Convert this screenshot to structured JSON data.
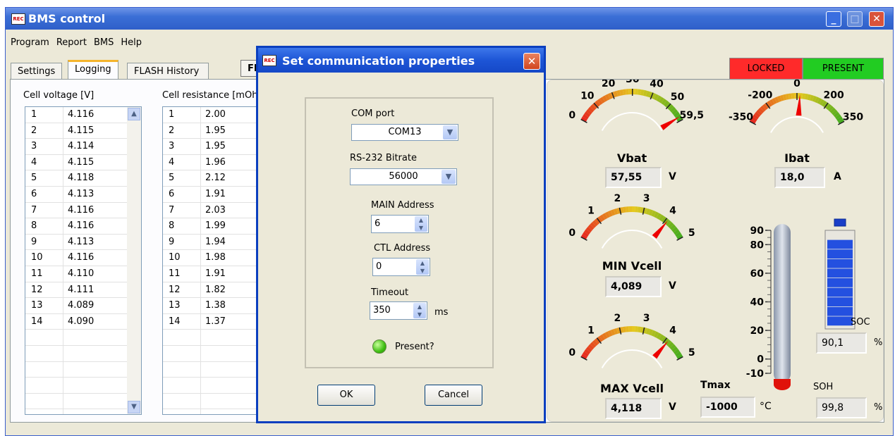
{
  "window": {
    "title": "BMS control",
    "app_icon_text": "REC",
    "controls": {
      "minimize": "_",
      "maximize": "□",
      "close": "✕"
    }
  },
  "menu": [
    "Program",
    "Report",
    "BMS",
    "Help"
  ],
  "tabs": [
    "Settings",
    "Logging",
    "FLASH History",
    "FE"
  ],
  "indicators": {
    "locked": {
      "label": "LOCKED",
      "color": "#ff2a2a"
    },
    "present": {
      "label": "PRESENT",
      "color": "#22cc22"
    }
  },
  "cell_voltage": {
    "label": "Cell voltage [V]",
    "rows": [
      [
        "1",
        "4.116"
      ],
      [
        "2",
        "4.115"
      ],
      [
        "3",
        "4.114"
      ],
      [
        "4",
        "4.115"
      ],
      [
        "5",
        "4.118"
      ],
      [
        "6",
        "4.113"
      ],
      [
        "7",
        "4.116"
      ],
      [
        "8",
        "4.116"
      ],
      [
        "9",
        "4.113"
      ],
      [
        "10",
        "4.116"
      ],
      [
        "11",
        "4.110"
      ],
      [
        "12",
        "4.111"
      ],
      [
        "13",
        "4.089"
      ],
      [
        "14",
        "4.090"
      ]
    ]
  },
  "cell_resistance": {
    "label": "Cell resistance [mOh",
    "rows": [
      [
        "1",
        "2.00"
      ],
      [
        "2",
        "1.95"
      ],
      [
        "3",
        "1.95"
      ],
      [
        "4",
        "1.96"
      ],
      [
        "5",
        "2.12"
      ],
      [
        "6",
        "1.91"
      ],
      [
        "7",
        "2.03"
      ],
      [
        "8",
        "1.99"
      ],
      [
        "9",
        "1.94"
      ],
      [
        "10",
        "1.98"
      ],
      [
        "11",
        "1.91"
      ],
      [
        "12",
        "1.82"
      ],
      [
        "13",
        "1.38"
      ],
      [
        "14",
        "1.37"
      ]
    ]
  },
  "gauges": {
    "vbat": {
      "label": "Vbat",
      "value": "57,55",
      "unit": "V",
      "min": 0,
      "max": 59.5,
      "reading": 57.55,
      "ticks": [
        "0",
        "10",
        "20",
        "30",
        "40",
        "50",
        "59,5"
      ]
    },
    "ibat": {
      "label": "Ibat",
      "value": "18,0",
      "unit": "A",
      "min": -350,
      "max": 350,
      "reading": 18.0,
      "ticks": [
        "-350",
        "-200",
        "0",
        "200",
        "350"
      ]
    },
    "min_vcell": {
      "label": "MIN Vcell",
      "value": "4,089",
      "unit": "V",
      "min": 0,
      "max": 5,
      "reading": 4.089,
      "ticks": [
        "0",
        "1",
        "2",
        "3",
        "4",
        "5"
      ]
    },
    "max_vcell": {
      "label": "MAX Vcell",
      "value": "4,118",
      "unit": "V",
      "min": 0,
      "max": 5,
      "reading": 4.118,
      "ticks": [
        "0",
        "1",
        "2",
        "3",
        "4",
        "5"
      ]
    }
  },
  "thermometer": {
    "label": "Tmax",
    "value": "-1000",
    "unit": "°C",
    "ticks": [
      "90",
      "80",
      "60",
      "40",
      "20",
      "0",
      "-10"
    ]
  },
  "soc": {
    "label": "SOC",
    "value": "90,1",
    "unit": "%",
    "fraction": 0.901
  },
  "soh": {
    "label": "SOH",
    "value": "99,8",
    "unit": "%"
  },
  "dialog": {
    "title": "Set communication properties",
    "com_port_label": "COM port",
    "com_port_value": "COM13",
    "bitrate_label": "RS-232 Bitrate",
    "bitrate_value": "56000",
    "main_address_label": "MAIN Address",
    "main_address_value": "6",
    "ctl_address_label": "CTL Address",
    "ctl_address_value": "0",
    "timeout_label": "Timeout",
    "timeout_value": "350",
    "timeout_unit": "ms",
    "present_label": "Present?",
    "ok_label": "OK",
    "cancel_label": "Cancel"
  }
}
